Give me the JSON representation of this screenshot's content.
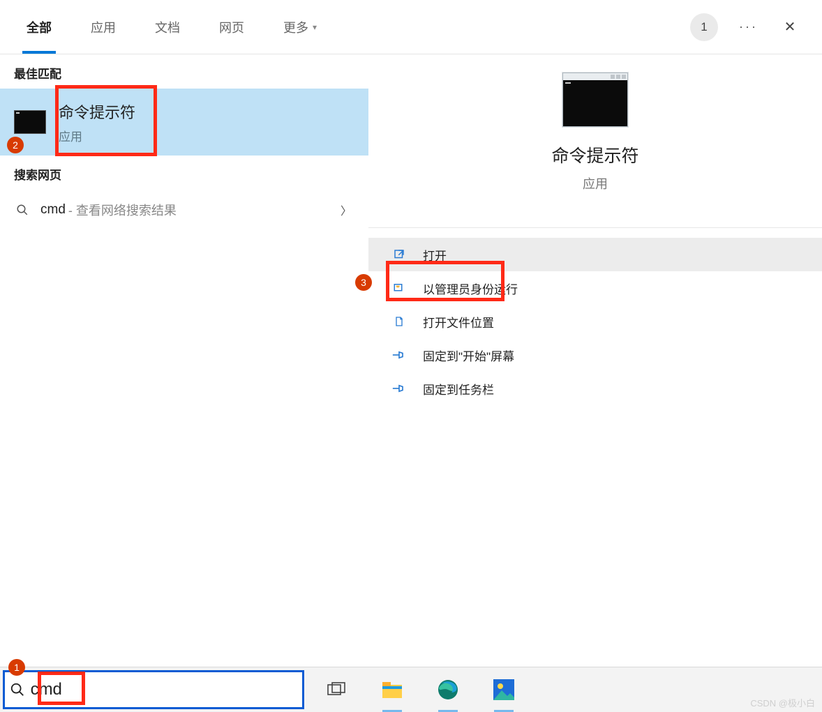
{
  "header": {
    "tabs": [
      "全部",
      "应用",
      "文档",
      "网页",
      "更多"
    ],
    "avatar_badge": "1"
  },
  "left": {
    "best_header": "最佳匹配",
    "best_title": "命令提示符",
    "best_subtitle": "应用",
    "web_header": "搜索网页",
    "web_query": "cmd",
    "web_hint": " - 查看网络搜索结果"
  },
  "right": {
    "title": "命令提示符",
    "subtitle": "应用",
    "actions": [
      {
        "label": "打开",
        "icon": "open"
      },
      {
        "label": "以管理员身份运行",
        "icon": "admin"
      },
      {
        "label": "打开文件位置",
        "icon": "folder"
      },
      {
        "label": "固定到\"开始\"屏幕",
        "icon": "pin"
      },
      {
        "label": "固定到任务栏",
        "icon": "pin"
      }
    ]
  },
  "taskbar": {
    "search_value": "cmd"
  },
  "annotations": {
    "n1": "1",
    "n2": "2",
    "n3": "3"
  },
  "watermark": "CSDN @极小白"
}
